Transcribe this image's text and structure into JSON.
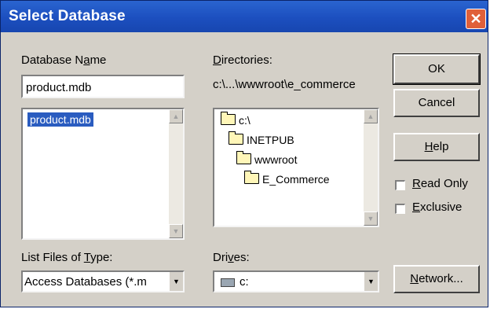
{
  "window": {
    "title": "Select Database",
    "close_glyph": "✕"
  },
  "database_name": {
    "label_pre": "Database N",
    "label_ul": "a",
    "label_post": "me",
    "value": "product.mdb",
    "files": [
      "product.mdb"
    ],
    "selected_index": 0
  },
  "directories": {
    "label_ul": "D",
    "label_post": "irectories:",
    "current_path": "c:\\...\\wwwroot\\e_commerce",
    "tree": [
      "c:\\",
      "INETPUB",
      "wwwroot",
      "E_Commerce"
    ]
  },
  "file_type": {
    "label_pre": "List Files of ",
    "label_ul": "T",
    "label_post": "ype:",
    "value": "Access Databases (*.m"
  },
  "drives": {
    "label_pre": "Dri",
    "label_ul": "v",
    "label_post": "es:",
    "value": "c:"
  },
  "buttons": {
    "ok": "OK",
    "cancel": "Cancel",
    "help_ul": "H",
    "help_post": "elp",
    "network_ul": "N",
    "network_post": "etwork..."
  },
  "options": {
    "read_only_ul": "R",
    "read_only_post": "ead Only",
    "read_only_checked": false,
    "exclusive_ul": "E",
    "exclusive_post": "xclusive",
    "exclusive_checked": false
  },
  "icons": [
    "close-icon",
    "scroll-up-icon",
    "scroll-down-icon",
    "folder-open-icon",
    "drive-icon",
    "dropdown-arrow-icon"
  ]
}
